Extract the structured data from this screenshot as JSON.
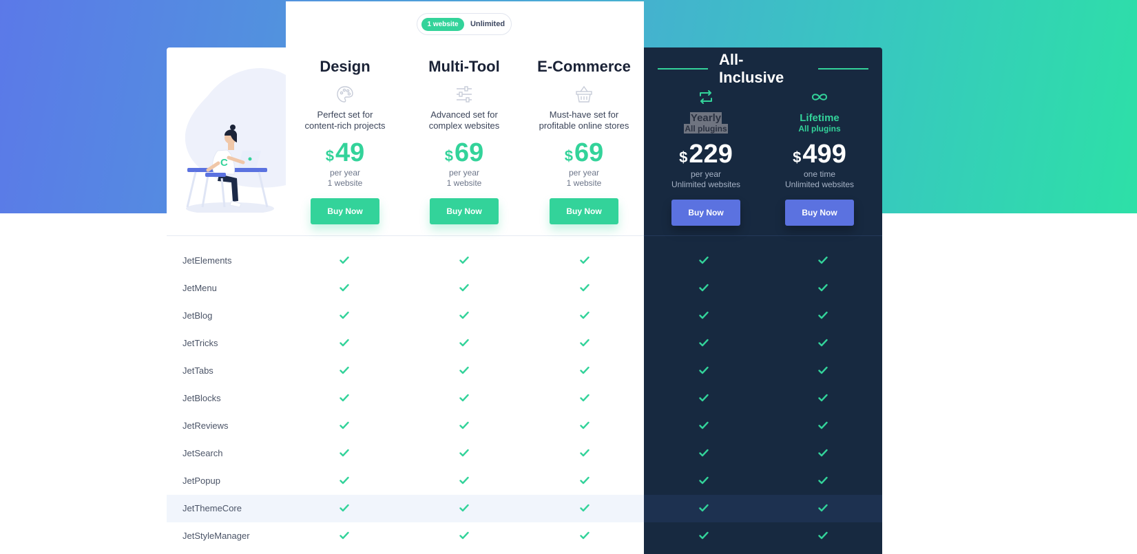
{
  "toggle": {
    "active": "1 website",
    "inactive": "Unlimited"
  },
  "plans": [
    {
      "id": "design",
      "title": "Design",
      "icon": "palette-icon",
      "desc_line1": "Perfect set for",
      "desc_line2": "content-rich projects",
      "currency": "$",
      "price": "49",
      "period": "per year",
      "sites": "1 website",
      "button": "Buy Now"
    },
    {
      "id": "multi-tool",
      "title": "Multi-Tool",
      "icon": "sliders-icon",
      "desc_line1": "Advanced set for",
      "desc_line2": "complex websites",
      "currency": "$",
      "price": "69",
      "period": "per year",
      "sites": "1 website",
      "button": "Buy Now"
    },
    {
      "id": "e-commerce",
      "title": "E-Commerce",
      "icon": "basket-icon",
      "desc_line1": "Must-have set for",
      "desc_line2": "profitable online stores",
      "currency": "$",
      "price": "69",
      "period": "per year",
      "sites": "1 website",
      "button": "Buy Now"
    }
  ],
  "all_inclusive": {
    "title": "All-Inclusive",
    "yearly": {
      "icon": "repeat-icon",
      "label": "Yearly",
      "sub": "All plugins",
      "currency": "$",
      "price": "229",
      "period": "per year",
      "sites": "Unlimited websites",
      "button": "Buy Now"
    },
    "lifetime": {
      "icon": "infinity-icon",
      "label": "Lifetime",
      "sub": "All plugins",
      "currency": "$",
      "price": "499",
      "period": "one time",
      "sites": "Unlimited websites",
      "button": "Buy Now"
    }
  },
  "colors": {
    "accent": "#33d39a",
    "dark_panel": "#172940",
    "button_blue": "#5b72e0"
  },
  "features": [
    {
      "name": "JetElements",
      "design": true,
      "multi_tool": true,
      "e_commerce": true,
      "yearly": true,
      "lifetime": true
    },
    {
      "name": "JetMenu",
      "design": true,
      "multi_tool": true,
      "e_commerce": true,
      "yearly": true,
      "lifetime": true
    },
    {
      "name": "JetBlog",
      "design": true,
      "multi_tool": true,
      "e_commerce": true,
      "yearly": true,
      "lifetime": true
    },
    {
      "name": "JetTricks",
      "design": true,
      "multi_tool": true,
      "e_commerce": true,
      "yearly": true,
      "lifetime": true
    },
    {
      "name": "JetTabs",
      "design": true,
      "multi_tool": true,
      "e_commerce": true,
      "yearly": true,
      "lifetime": true
    },
    {
      "name": "JetBlocks",
      "design": true,
      "multi_tool": true,
      "e_commerce": true,
      "yearly": true,
      "lifetime": true
    },
    {
      "name": "JetReviews",
      "design": true,
      "multi_tool": true,
      "e_commerce": true,
      "yearly": true,
      "lifetime": true
    },
    {
      "name": "JetSearch",
      "design": true,
      "multi_tool": true,
      "e_commerce": true,
      "yearly": true,
      "lifetime": true
    },
    {
      "name": "JetPopup",
      "design": true,
      "multi_tool": true,
      "e_commerce": true,
      "yearly": true,
      "lifetime": true
    },
    {
      "name": "JetThemeCore",
      "design": true,
      "multi_tool": true,
      "e_commerce": true,
      "yearly": true,
      "lifetime": true,
      "highlighted": true
    },
    {
      "name": "JetStyleManager",
      "design": true,
      "multi_tool": true,
      "e_commerce": true,
      "yearly": true,
      "lifetime": true
    }
  ]
}
